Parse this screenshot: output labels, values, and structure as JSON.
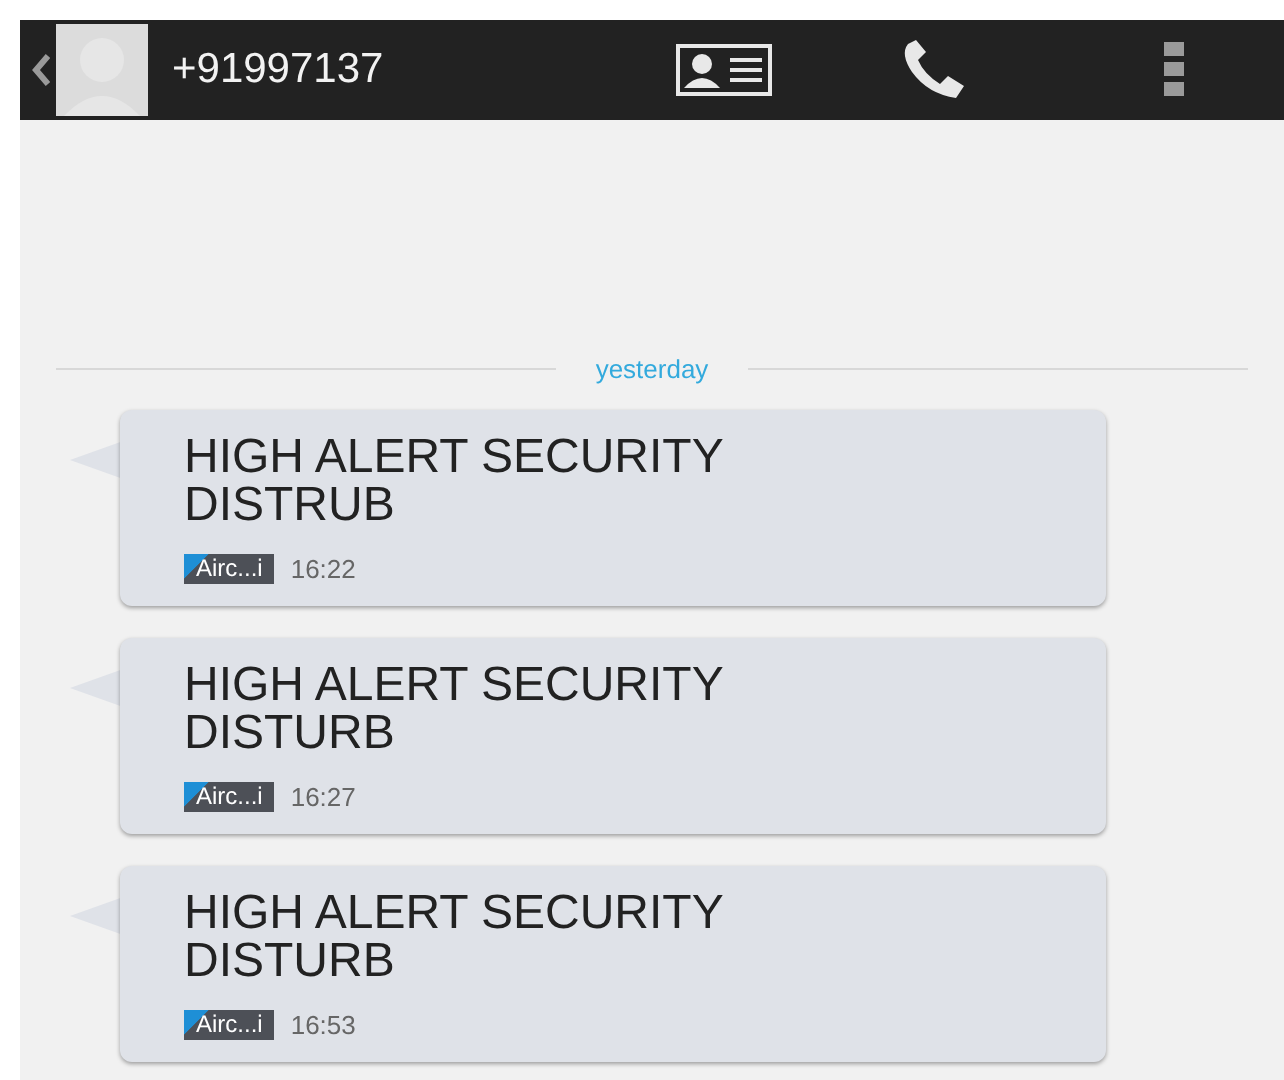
{
  "header": {
    "title": "+91997137"
  },
  "date_divider": "yesterday",
  "messages": [
    {
      "text": "HIGH ALERT SECURITY DISTRUB",
      "sim_label": "Airc...i",
      "time": "16:22"
    },
    {
      "text": "HIGH ALERT SECURITY DISTURB",
      "sim_label": "Airc...i",
      "time": "16:27"
    },
    {
      "text": "HIGH ALERT SECURITY DISTURB",
      "sim_label": "Airc...i",
      "time": "16:53"
    }
  ]
}
